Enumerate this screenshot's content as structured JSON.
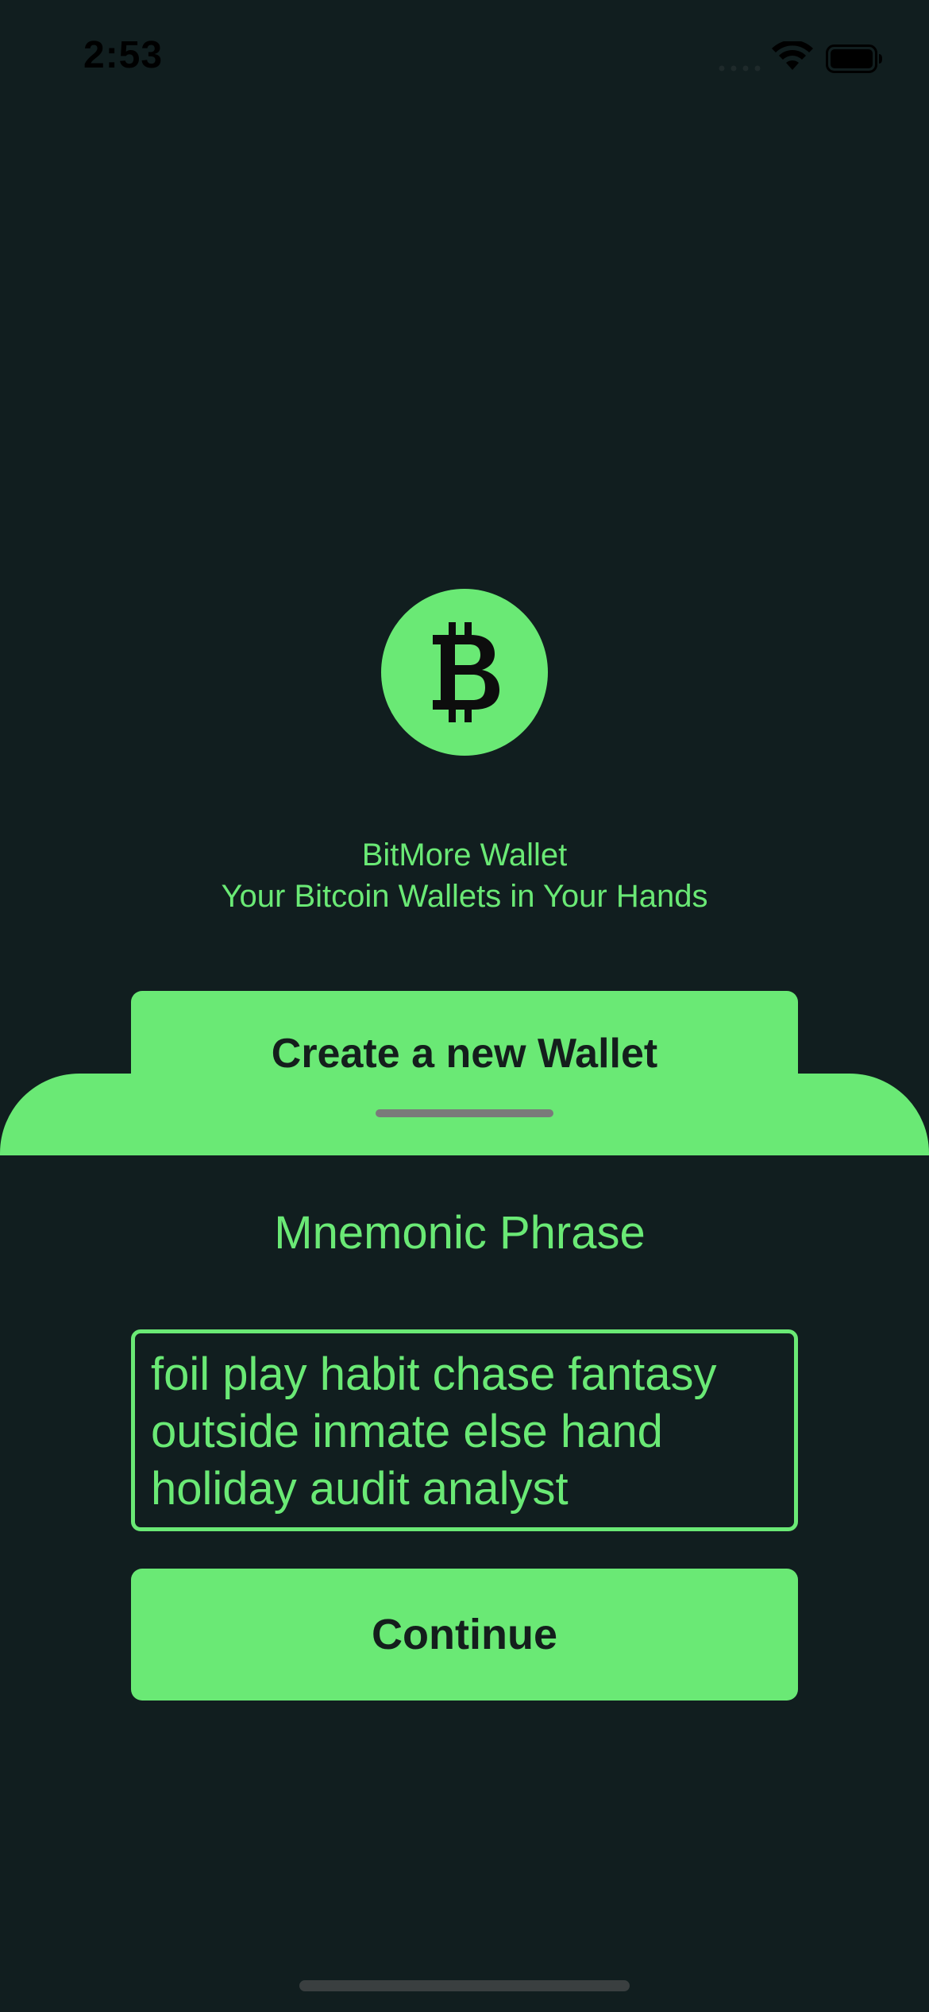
{
  "status_bar": {
    "time": "2:53"
  },
  "app": {
    "name": "BitMore Wallet",
    "tagline": "Your Bitcoin Wallets in Your Hands",
    "logo_icon": "bitcoin-icon"
  },
  "sheet": {
    "title": "Create a new Wallet"
  },
  "mnemonic": {
    "label": "Mnemonic Phrase",
    "value": "foil play habit chase fantasy outside inmate else hand holiday audit analyst"
  },
  "actions": {
    "continue_label": "Continue"
  },
  "colors": {
    "background": "#111e1f",
    "accent": "#6ae975",
    "dark_text": "#141e1c"
  }
}
